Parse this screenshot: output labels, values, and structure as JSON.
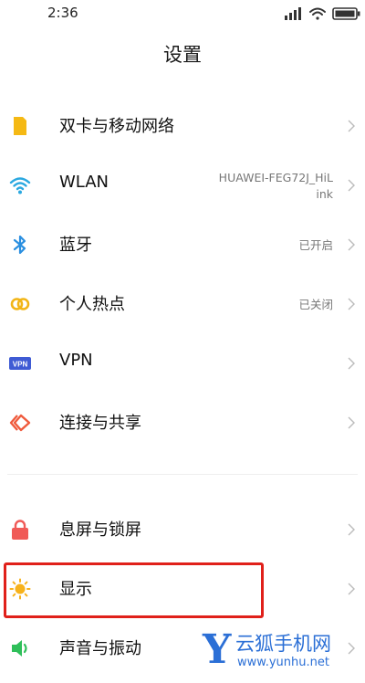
{
  "status_bar": {
    "time": "2:36"
  },
  "header": {
    "title": "设置"
  },
  "settings": {
    "dual_sim": {
      "label": "双卡与移动网络"
    },
    "wlan": {
      "label": "WLAN",
      "value_line1": "HUAWEI-FEG72J_HiL",
      "value_line2": "ink"
    },
    "bluetooth": {
      "label": "蓝牙",
      "value": "已开启"
    },
    "hotspot": {
      "label": "个人热点",
      "value": "已关闭"
    },
    "vpn": {
      "label": "VPN",
      "icon_text": "VPN"
    },
    "connect_share": {
      "label": "连接与共享"
    },
    "lock_screen": {
      "label": "息屏与锁屏"
    },
    "display": {
      "label": "显示"
    },
    "sound": {
      "label": "声音与振动"
    }
  },
  "watermark": {
    "letter": "Y",
    "name": "云狐手机网",
    "url": "www.yunhu.net"
  },
  "colors": {
    "sim_icon": "#f5b914",
    "wifi_icon": "#2aa8e0",
    "bluetooth_icon": "#2a8fe0",
    "hotspot_icon": "#f2b516",
    "vpn_icon": "#3f5bd4",
    "share_icon": "#ef5a3c",
    "lock_icon": "#f05a57",
    "display_icon": "#f7b21b",
    "sound_icon": "#2fbf5a",
    "highlight": "#e0201a",
    "watermark": "#2b6fd6"
  }
}
